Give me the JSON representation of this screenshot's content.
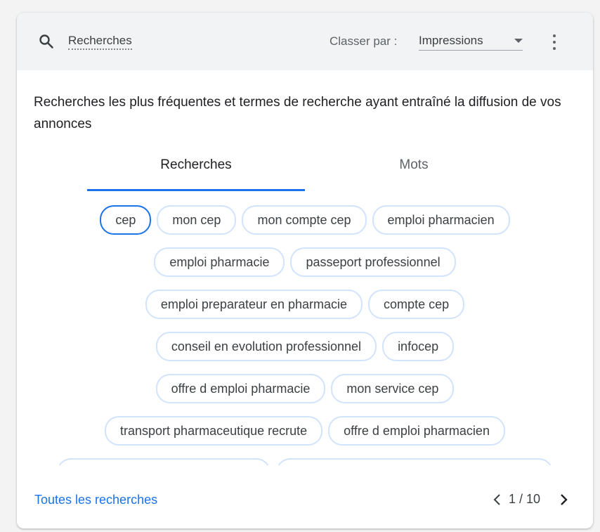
{
  "header": {
    "title": "Recherches",
    "sort_label": "Classer par :",
    "sort_value": "Impressions",
    "search_icon": "search-icon",
    "more_icon": "more-vert-icon"
  },
  "description": "Recherches les plus fréquentes et termes de recherche ayant entraîné la diffusion de vos annonces",
  "tabs": [
    {
      "label": "Recherches",
      "active": true
    },
    {
      "label": "Mots",
      "active": false
    }
  ],
  "chips": [
    [
      "cep",
      "mon cep",
      "mon compte cep",
      "emploi pharmacien"
    ],
    [
      "emploi pharmacie",
      "passeport professionnel"
    ],
    [
      "emploi preparateur en pharmacie",
      "compte cep"
    ],
    [
      "conseil en evolution professionnel",
      "infocep"
    ],
    [
      "offre d emploi pharmacie",
      "mon service cep"
    ],
    [
      "transport pharmaceutique recrute",
      "offre d emploi pharmacien"
    ]
  ],
  "footer": {
    "link": "Toutes les recherches",
    "page": "1 / 10"
  },
  "colors": {
    "accent": "#1a73e8",
    "chip_border": "#d2e3fc",
    "header_bg": "#f1f3f4"
  }
}
